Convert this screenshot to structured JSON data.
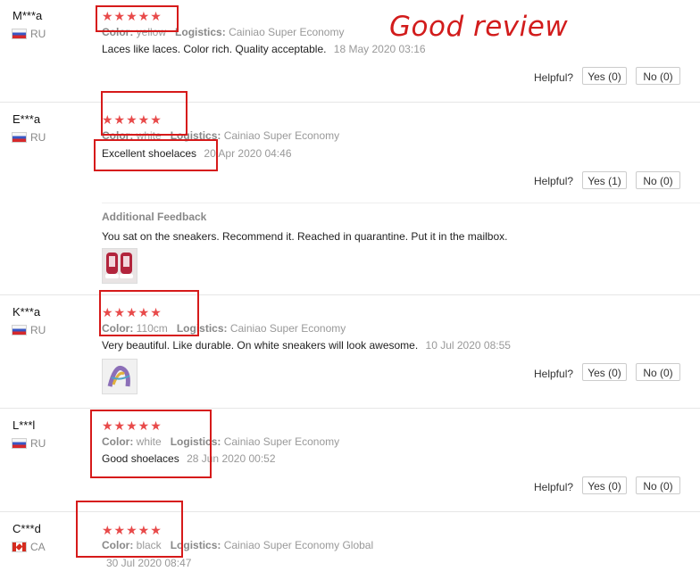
{
  "watermark": "Good review",
  "labels": {
    "color": "Color:",
    "logistics": "Logistics:",
    "helpful": "Helpful?",
    "additional_feedback": "Additional Feedback"
  },
  "reviews": [
    {
      "user": "M***a",
      "country": "RU",
      "stars": "★★★★★",
      "rating": 5,
      "color": "yellow",
      "logistics": "Cainiao Super Economy",
      "text": "Laces like laces. Color rich. Quality acceptable.",
      "date": "18 May 2020 03:16",
      "yes": "Yes (0)",
      "no": "No (0)"
    },
    {
      "user": "E***a",
      "country": "RU",
      "stars": "★★★★★",
      "rating": 5,
      "color": "white",
      "logistics": "Cainiao Super Economy",
      "text": "Excellent shoelaces",
      "date": "20 Apr 2020 04:46",
      "yes": "Yes (1)",
      "no": "No (0)",
      "additional": "You sat on the sneakers. Recommend it. Reached in quarantine. Put it in the mailbox."
    },
    {
      "user": "K***a",
      "country": "RU",
      "stars": "★★★★★",
      "rating": 5,
      "color": "110cm",
      "logistics": "Cainiao Super Economy",
      "text": "Very beautiful. Like durable. On white sneakers will look awesome.",
      "date": "10 Jul 2020 08:55",
      "yes": "Yes (0)",
      "no": "No (0)"
    },
    {
      "user": "L***l",
      "country": "RU",
      "stars": "★★★★★",
      "rating": 5,
      "color": "white",
      "logistics": "Cainiao Super Economy",
      "text": "Good shoelaces",
      "date": "28 Jun 2020 00:52",
      "yes": "Yes (0)",
      "no": "No (0)"
    },
    {
      "user": "C***d",
      "country": "CA",
      "stars": "★★★★★",
      "rating": 5,
      "color": "black",
      "logistics": "Cainiao Super Economy Global",
      "text": "",
      "date": "30 Jul 2020 08:47"
    }
  ]
}
